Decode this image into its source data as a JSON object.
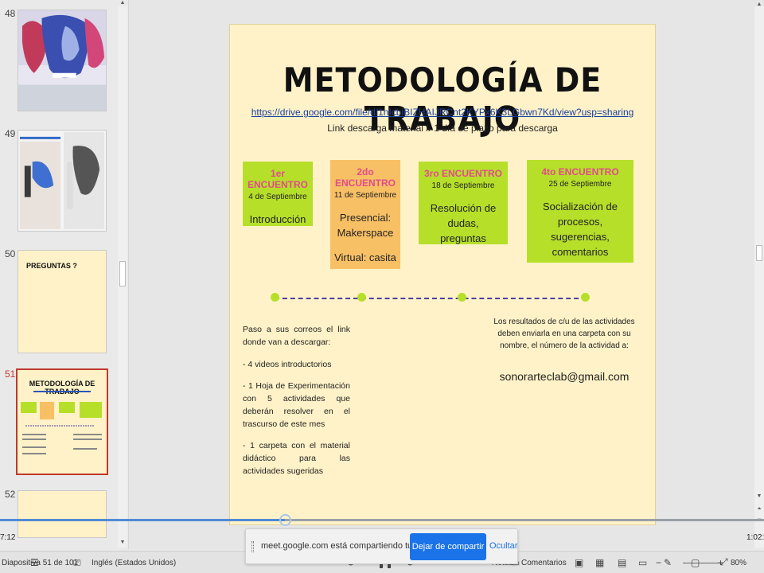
{
  "thumbnails": [
    {
      "num": "48",
      "kind": "image-art",
      "active": false
    },
    {
      "num": "49",
      "kind": "image-photos",
      "active": false
    },
    {
      "num": "50",
      "kind": "text",
      "label": "PREGUNTAS ?",
      "active": false
    },
    {
      "num": "51",
      "kind": "metodologia",
      "label": "METODOLOGÍA DE TRABAJO",
      "active": true
    },
    {
      "num": "52",
      "kind": "blank",
      "active": false
    }
  ],
  "slide": {
    "title": "METODOLOGÍA DE TRABAJO",
    "link": "https://drive.google.com/file/d/1nIcbiBIZHAIJRCnt2KYPx6K3LGbwn7Kd/view?usp=sharing",
    "subtitle": "Link descarga material  // 1 día de plazo para descarga",
    "cards": [
      {
        "header": "1er ENCUENTRO",
        "date": "4 de Septiembre",
        "body": "Introducción"
      },
      {
        "header": "2do ENCUENTRO",
        "date": "11 de Septiembre",
        "body1": "Presencial: Makerspace",
        "body2": "Virtual: casita"
      },
      {
        "header": "3ro ENCUENTRO",
        "date": "18 de Septiembre",
        "body": "Resolución de dudas, preguntas"
      },
      {
        "header": "4to ENCUENTRO",
        "date": "25 de Septiembre",
        "body": "Socialización de procesos, sugerencias, comentarios"
      }
    ],
    "left_text": [
      "Paso a sus correos el link donde van a descargar:",
      "-  4 videos introductorios",
      "-  1 Hoja de Experimentación con 5 actividades que deberán resolver en el trascurso de este mes",
      "-  1 carpeta con el material didáctico para las actividades sugeridas"
    ],
    "right_text": "Los resultados de c/u de las actividades deben enviarla en una carpeta con su nombre, el número de la actividad a:",
    "email": "sonorarteclab@gmail.com"
  },
  "player": {
    "time_left": "7:12",
    "time_right": "1:02:"
  },
  "share_banner": {
    "message": "meet.google.com está compartiendo tu pantalla.",
    "stop_label": "Dejar de compartir",
    "hide_label": "Ocultar"
  },
  "statusbar": {
    "slide_info": "Diapositiva 51 de 101",
    "language": "Inglés (Estados Unidos)",
    "notes": "Notas",
    "comments": "Comentarios",
    "zoom": "80%"
  }
}
